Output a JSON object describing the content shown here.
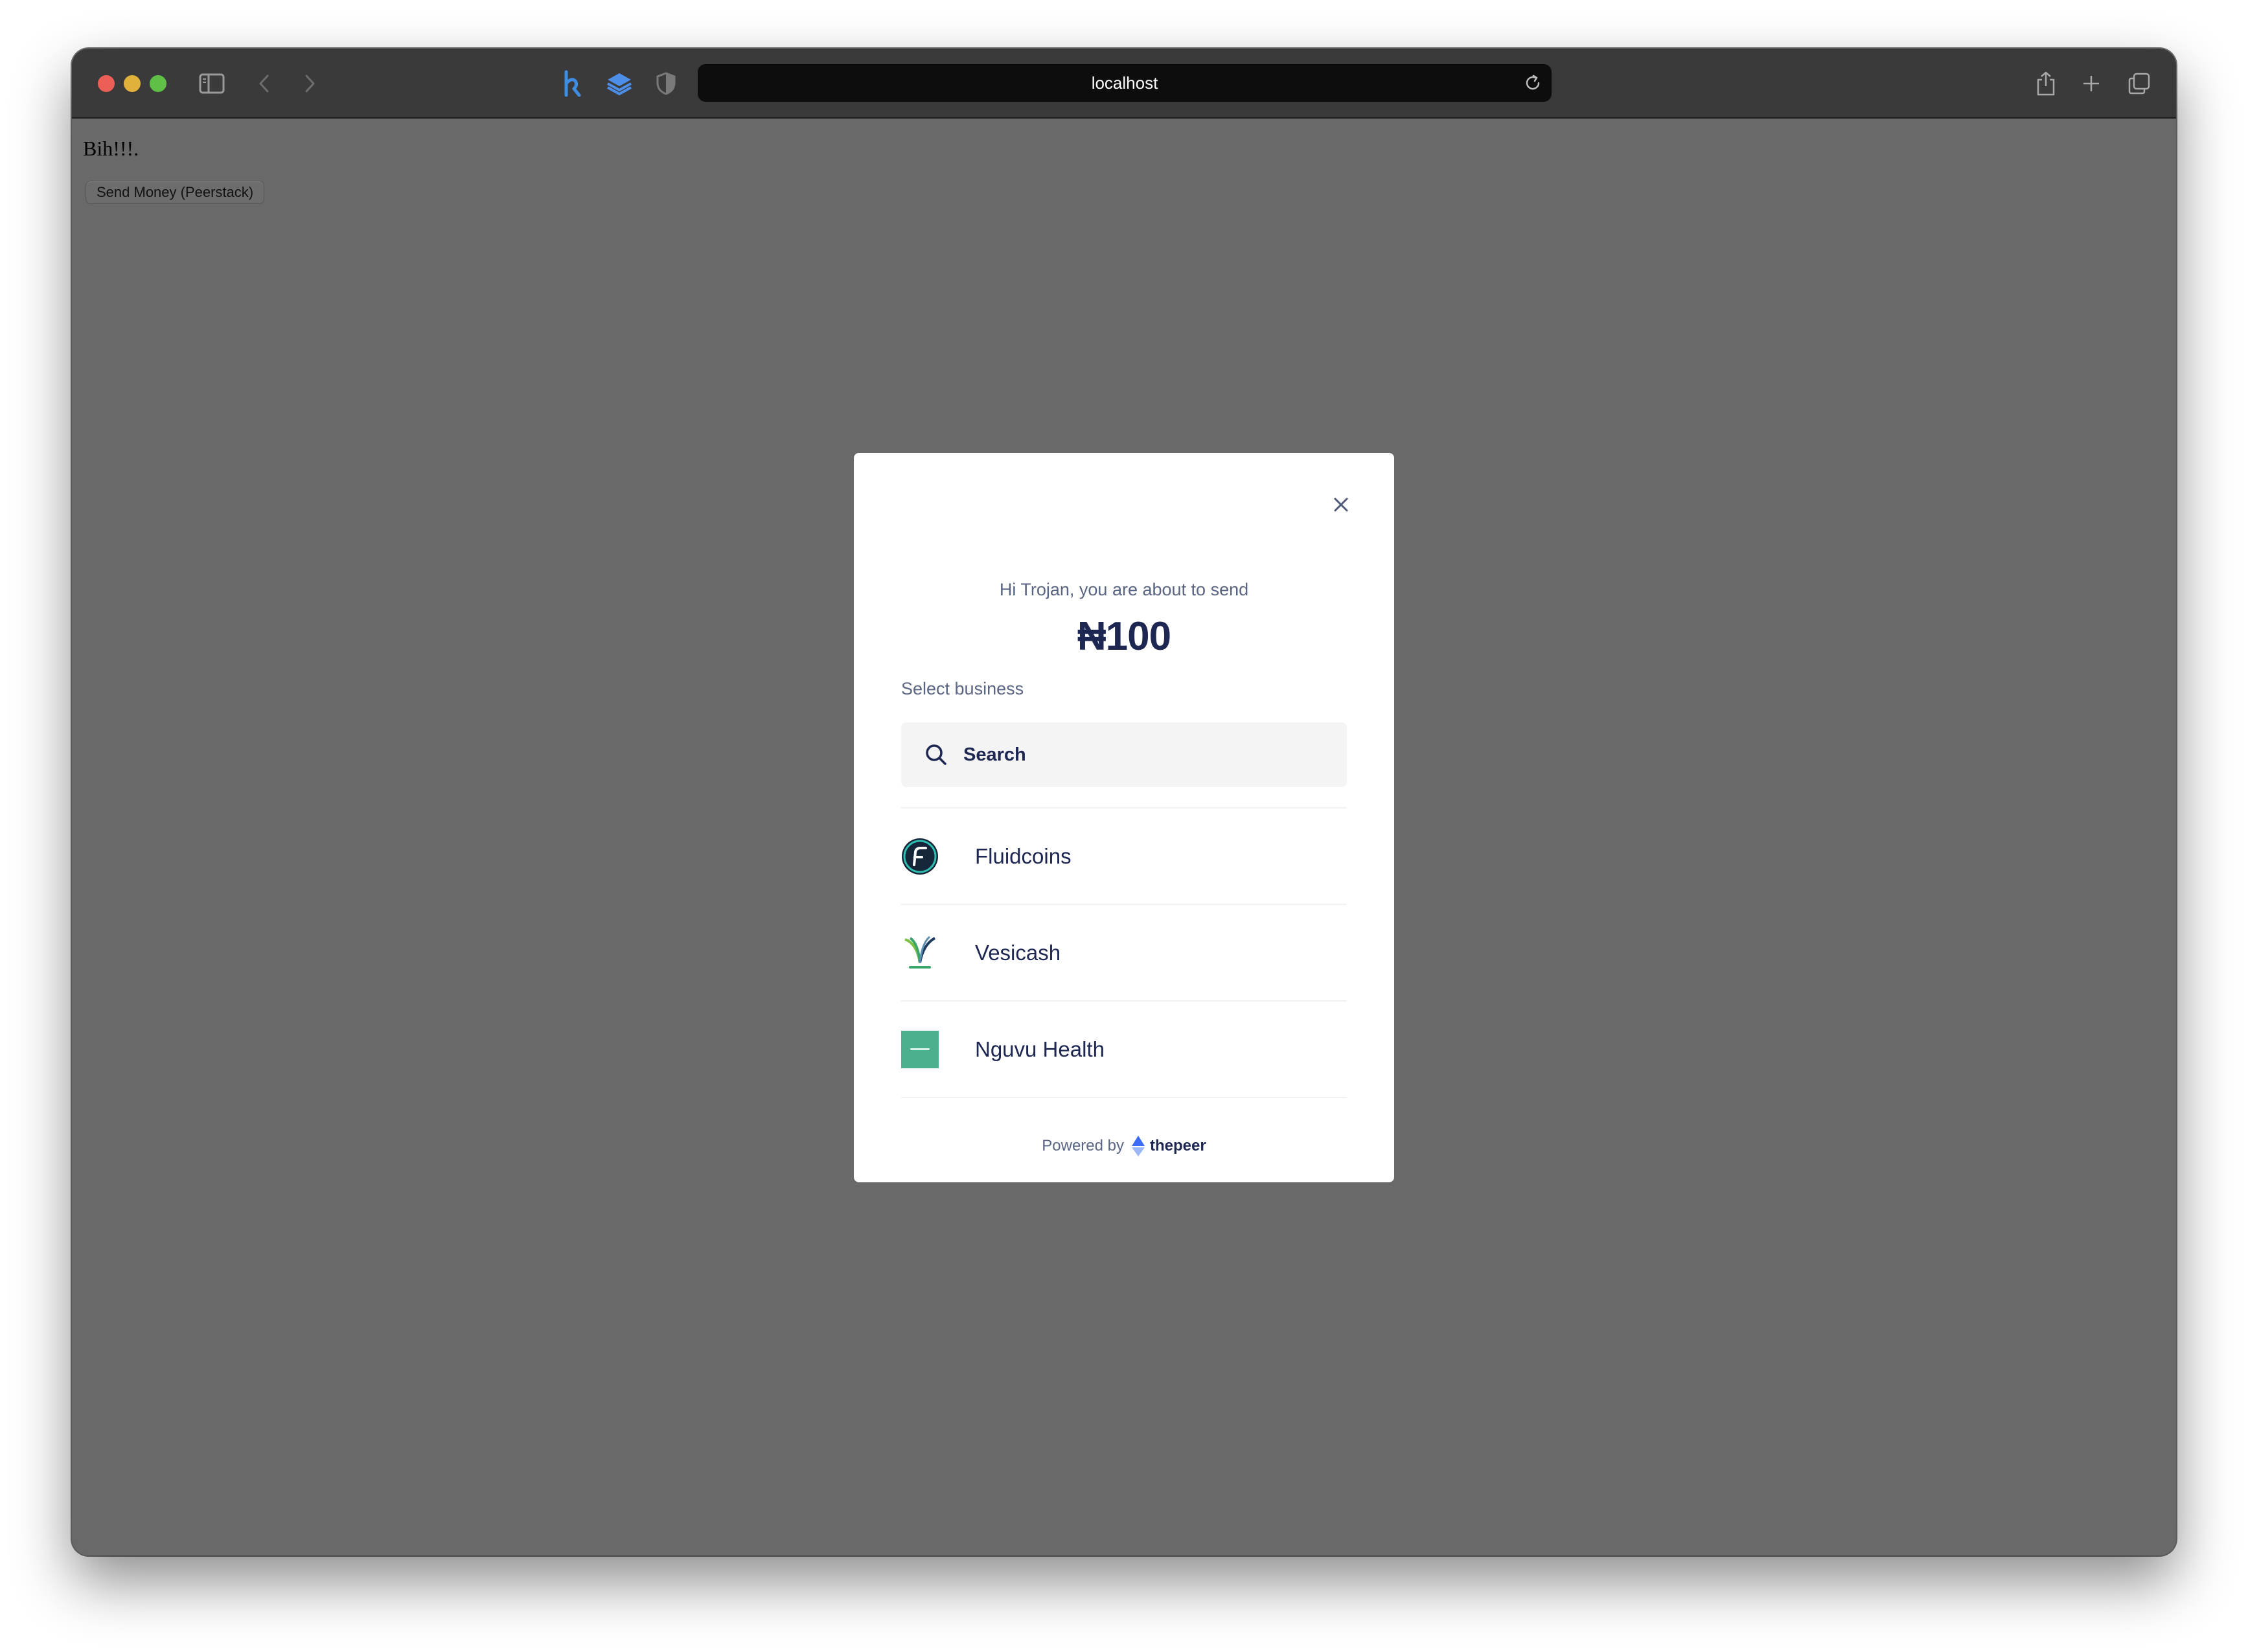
{
  "browser": {
    "url": "localhost",
    "icons": [
      "sidebar-icon",
      "back-icon",
      "forward-icon",
      "honey-extension-icon",
      "layers-extension-icon",
      "shield-extension-icon",
      "reload-icon",
      "share-icon",
      "new-tab-icon",
      "tab-overview-icon"
    ]
  },
  "page": {
    "heading": "Bih!!!.",
    "button_label": "Send Money (Peerstack)"
  },
  "modal": {
    "greeting": "Hi Trojan, you are about to send",
    "amount": "₦100",
    "select_label": "Select business",
    "search_placeholder": "Search",
    "businesses": [
      {
        "name": "Fluidcoins",
        "logo": "fluidcoins-logo"
      },
      {
        "name": "Vesicash",
        "logo": "vesicash-logo"
      },
      {
        "name": "Nguvu Health",
        "logo": "nguvu-health-logo"
      }
    ],
    "footer": {
      "powered_by": "Powered by",
      "brand": "thepeer"
    }
  },
  "colors": {
    "overlay": "#696969",
    "text_dark": "#1d2752",
    "text_muted": "#5a6584",
    "brand_blue": "#3c6cf5",
    "nguvu_green": "#4caf8e"
  }
}
